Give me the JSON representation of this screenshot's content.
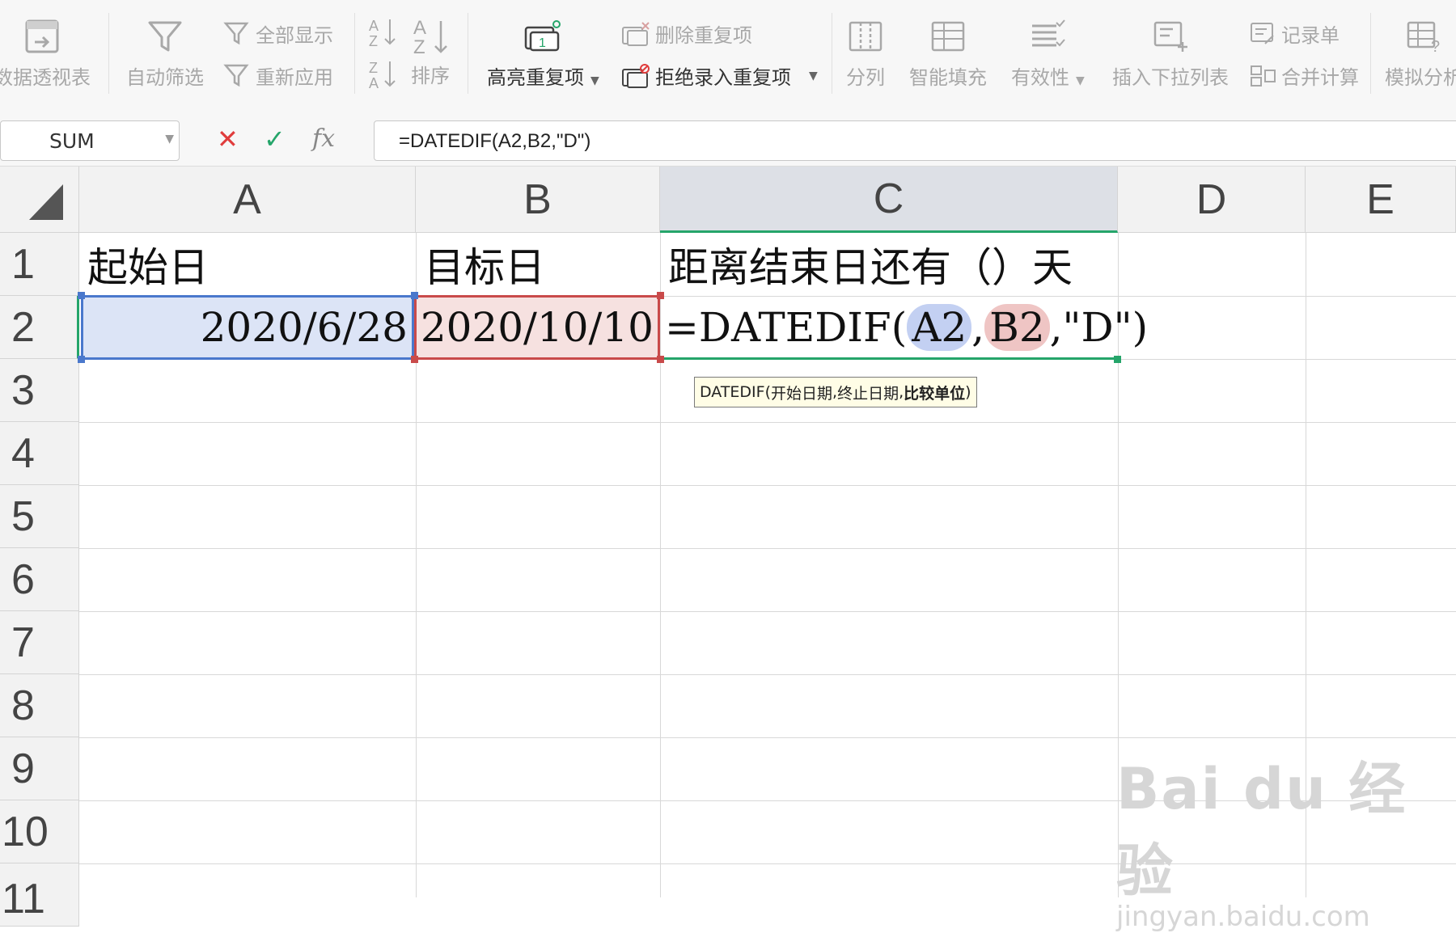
{
  "ribbon": {
    "pivot_label": "数据透视表",
    "autofilter_label": "自动筛选",
    "show_all_label": "全部显示",
    "reapply_label": "重新应用",
    "sort_label": "排序",
    "highlight_dup_label": "高亮重复项",
    "delete_dup_label": "删除重复项",
    "reject_dup_label": "拒绝录入重复项",
    "split_label": "分列",
    "flash_fill_label": "智能填充",
    "validity_label": "有效性",
    "insert_dropdown_label": "插入下拉列表",
    "record_label": "记录单",
    "consolidate_label": "合并计算",
    "whatif_label": "模拟分析"
  },
  "formula_bar": {
    "name_box": "SUM",
    "cancel_glyph": "✕",
    "confirm_glyph": "✓",
    "fx_glyph": "fx",
    "formula": "=DATEDIF(A2,B2,\"D\")"
  },
  "grid": {
    "columns": [
      "A",
      "B",
      "C",
      "D",
      "E"
    ],
    "rows": [
      "1",
      "2",
      "3",
      "4",
      "5",
      "6",
      "7",
      "8",
      "9",
      "10",
      "11"
    ],
    "cells": {
      "A1": "起始日",
      "B1": "目标日",
      "C1": "距离结束日还有（）天",
      "A2": "2020/6/28",
      "B2": "2020/10/10"
    },
    "edit_formula": {
      "prefix": "=DATEDIF(",
      "ref1": "A2",
      "comma1": ",",
      "ref2": "B2",
      "suffix": ",\"D\")"
    }
  },
  "tooltip": {
    "func": "DATEDIF",
    "open": " (",
    "arg1": "开始日期",
    "sep1": ", ",
    "arg2": "终止日期",
    "sep2": ", ",
    "arg3": "比较单位",
    "close": ")"
  },
  "watermark": {
    "brand": "Bai du 经验",
    "url": "jingyan.baidu.com"
  },
  "colors": {
    "active_green": "#25a56a",
    "ref_blue": "#4a78cc",
    "ref_red": "#c94a4a",
    "cancel_red": "#e03c3c"
  }
}
